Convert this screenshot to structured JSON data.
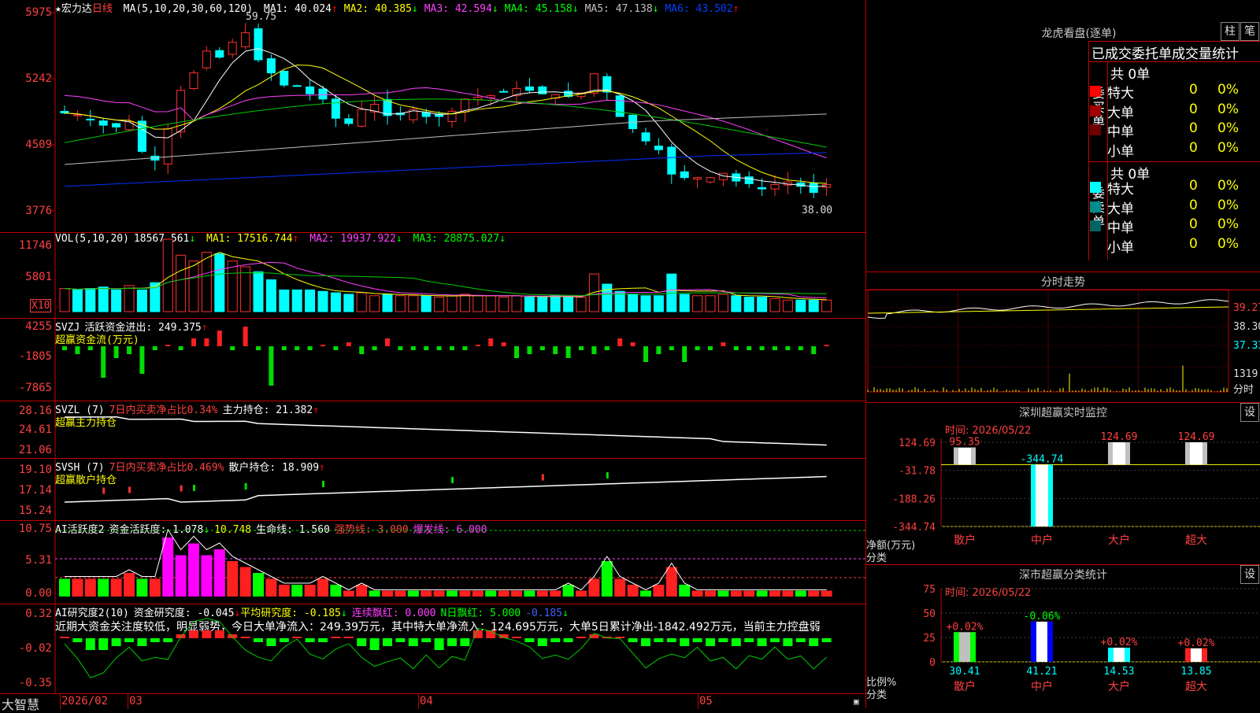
{
  "main": {
    "title_star": "★宏力达",
    "period": "日线",
    "ma_params": "MA(5,10,20,30,60,120)",
    "ma_items": [
      {
        "label": "MA1: 40.024",
        "arrow": "↑",
        "color": "#ffffff"
      },
      {
        "label": "MA2: 40.385",
        "arrow": "↓",
        "color": "#ffff00"
      },
      {
        "label": "MA3: 42.594",
        "arrow": "↓",
        "color": "#ff40ff"
      },
      {
        "label": "MA4: 45.158",
        "arrow": "↓",
        "color": "#00ff00"
      },
      {
        "label": "MA5: 47.138",
        "arrow": "↓",
        "color": "#c0c0c0"
      },
      {
        "label": "MA6: 43.502",
        "arrow": "↑",
        "color": "#0040ff"
      }
    ],
    "y_labels": [
      "5975",
      "5242",
      "4509",
      "3776"
    ],
    "high_mark": "59.75",
    "low_mark": "38.00"
  },
  "vol": {
    "title": "VOL(5,10,20)",
    "value": "18567.561",
    "arrow": "↓",
    "ma1": "MA1: 17516.744",
    "ma1_arrow": "↑",
    "ma2": "MA2: 19937.922",
    "ma2_arrow": "↓",
    "ma3": "MA3: 28875.027",
    "ma3_arrow": "↓",
    "y_labels": [
      "11746",
      "5801"
    ],
    "unit": "X10"
  },
  "svzj": {
    "title": "SVZJ",
    "label": "活跃资金进出: 249.375",
    "arrow": "↑",
    "sub": "超赢资金流(万元)",
    "y_labels": [
      "4255",
      "-1805",
      "-7865"
    ]
  },
  "svzl": {
    "title": "SVZL (7)",
    "label1": "7日内买卖净占比0.34%",
    "label2": "主力持仓: 21.382",
    "arrow": "↑",
    "sub": "超赢主力持仓",
    "y_labels": [
      "28.16",
      "24.61",
      "21.06"
    ]
  },
  "svsh": {
    "title": "SVSH (7)",
    "label1": "7日内买卖净占比0.469%",
    "label2": "散户持仓: 18.909",
    "arrow": "↑",
    "sub": "超赢散户持仓",
    "y_labels": [
      "19.10",
      "17.14",
      "15.24"
    ]
  },
  "ai1": {
    "title": "AI活跃度2",
    "l1": "资金活跃度: 1.078",
    "l1a": "↓",
    "l2": "10.748",
    "l3": "生命线: 1.560",
    "l4": "强势线: 3.000",
    "l5": "爆发线: 6.000",
    "y_labels": [
      "10.75",
      "5.31",
      "0.00"
    ]
  },
  "ai2": {
    "title": "AI研究度2(10)",
    "l1": "资金研究度: -0.045",
    "l1a": "↓",
    "l2": "平均研究度: -0.185",
    "l2a": "↓",
    "l3": "连续飘红: 0.000",
    "l4": "N日飘红: 5.000",
    "l5": "-0.185",
    "l5a": "↓",
    "text": "近期大资金关注度较低，明显弱势，今日大单净流入：249.39万元，其中特大单净流入：124.695万元，大单5日累计净出-1842.492万元，当前主力控盘弱",
    "y_labels": [
      "0.32",
      "-0.02",
      "-0.35"
    ]
  },
  "bottom": {
    "brand": "大智慧",
    "dates": [
      "2026/02",
      "03",
      "04",
      "05"
    ]
  },
  "dragon": {
    "title": "龙虎看盘(逐单)",
    "btn1": "柱",
    "btn2": "笔",
    "header": "已成交委托单成交量统计",
    "buy_label": "委买单",
    "sell_label": "委卖单",
    "buy_count": "共 0单",
    "sell_count": "共 0单",
    "rows_buy": [
      {
        "name": "特大",
        "val": "0",
        "pct": "0%",
        "color": "#ff0000"
      },
      {
        "name": "大单",
        "val": "0",
        "pct": "0%",
        "color": "#a00000"
      },
      {
        "name": "中单",
        "val": "0",
        "pct": "0%",
        "color": "#700000"
      },
      {
        "name": "小单",
        "val": "0",
        "pct": "0%",
        "color": ""
      }
    ],
    "rows_sell": [
      {
        "name": "特大",
        "val": "0",
        "pct": "0%",
        "color": "#00ffff"
      },
      {
        "name": "大单",
        "val": "0",
        "pct": "0%",
        "color": "#008c8c"
      },
      {
        "name": "中单",
        "val": "0",
        "pct": "0%",
        "color": "#006464"
      },
      {
        "name": "小单",
        "val": "0",
        "pct": "0%",
        "color": ""
      }
    ]
  },
  "intraday": {
    "title": "分时走势",
    "prices": [
      "39.27",
      "38.30",
      "37.33"
    ],
    "vol": "1319",
    "vol_unit": "分时"
  },
  "monitor": {
    "title": "深圳超赢实时监控",
    "btn": "设",
    "time": "时间: 2026/05/22",
    "y_labels": [
      "124.69",
      "-31.78",
      "-188.26",
      "-344.74"
    ],
    "ylabel": "净额(万元)",
    "xlabel": "分类",
    "categories": [
      "散户",
      "中户",
      "大户",
      "超大"
    ],
    "values_label": [
      "95.35",
      "-344.74",
      "124.69",
      "124.69"
    ]
  },
  "classify": {
    "title": "深市超赢分类统计",
    "btn": "设",
    "time": "时间: 2026/05/22",
    "y_labels": [
      "75",
      "50",
      "25",
      "0"
    ],
    "ylabel": "比例%",
    "xlabel": "分类",
    "categories": [
      "散户",
      "中户",
      "大户",
      "超大"
    ],
    "pct": [
      "30.41",
      "41.21",
      "14.53",
      "13.85"
    ],
    "delta": [
      "+0.02%",
      "-0.06%",
      "+0.02%",
      "+0.02%"
    ]
  },
  "chart_data": {
    "type": "bar",
    "title": "深圳超赢实时监控",
    "categories": [
      "散户",
      "中户",
      "大户",
      "超大"
    ],
    "series": [
      {
        "name": "净额(万元)",
        "values": [
          95.35,
          -344.74,
          124.69,
          124.69
        ]
      }
    ],
    "ylim": [
      -344.74,
      124.69
    ]
  }
}
